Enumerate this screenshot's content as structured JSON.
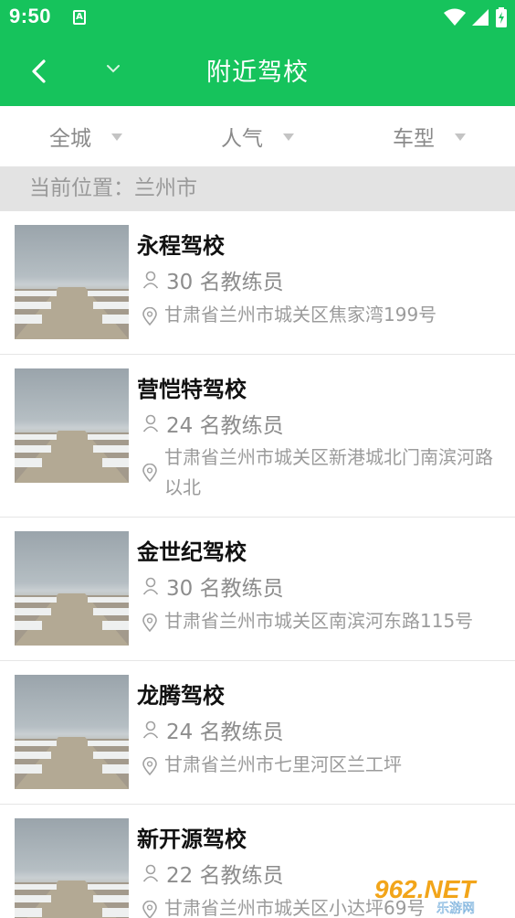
{
  "status": {
    "time": "9:50",
    "notif": "A"
  },
  "appbar": {
    "title": "附近驾校"
  },
  "filters": [
    {
      "label": "全城"
    },
    {
      "label": "人气"
    },
    {
      "label": "车型"
    }
  ],
  "location": {
    "text": "当前位置：兰州市"
  },
  "schools": [
    {
      "name": "永程驾校",
      "coaches": "30 名教练员",
      "address": "甘肃省兰州市城关区焦家湾199号"
    },
    {
      "name": "营恺特驾校",
      "coaches": "24 名教练员",
      "address": "甘肃省兰州市城关区新港城北门南滨河路以北"
    },
    {
      "name": "金世纪驾校",
      "coaches": "30 名教练员",
      "address": "甘肃省兰州市城关区南滨河东路115号"
    },
    {
      "name": "龙腾驾校",
      "coaches": "24 名教练员",
      "address": "甘肃省兰州市七里河区兰工坪"
    },
    {
      "name": "新开源驾校",
      "coaches": "22 名教练员",
      "address": "甘肃省兰州市城关区小达坪69号"
    }
  ],
  "watermark": {
    "main": "962.NET",
    "sub": "乐游网"
  },
  "colors": {
    "accent": "#16c35c",
    "location_bar": "#e3e3e3"
  },
  "icons": {
    "back": "back-arrow-icon",
    "caret": "chevron-down-icon",
    "coach": "person-icon",
    "address": "location-pin-icon"
  }
}
